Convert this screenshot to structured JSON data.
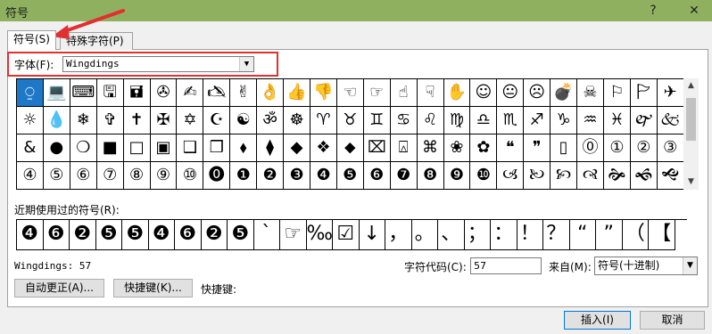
{
  "window": {
    "title": "符号",
    "help": "?",
    "close": "✕",
    "titlebar_color": "#8fb15f"
  },
  "tabs": [
    {
      "label": "符号(S)",
      "active": true
    },
    {
      "label": "特殊字符(P)",
      "active": false
    }
  ],
  "font": {
    "label": "字体(F):",
    "value": "Wingdings"
  },
  "symbol_grid": {
    "rows": [
      [
        "⍜",
        "💻",
        "⌨",
        "🖫",
        "🖬",
        "✇",
        "✍",
        "🖎",
        "✌",
        "👌",
        "👍",
        "👎",
        "☜",
        "☞",
        "☝",
        "☟",
        "✋",
        "☺",
        "😐",
        "☹",
        "💣",
        "☠",
        "⚐",
        "🏱",
        "✈"
      ],
      [
        "☼",
        "💧",
        "❄",
        "✞",
        "✝",
        "✠",
        "✡",
        "☪",
        "☯",
        "ॐ",
        "☸",
        "♈",
        "♉",
        "♊",
        "♋",
        "♌",
        "♍",
        "♎",
        "♏",
        "♐",
        "♑",
        "♒",
        "♓",
        "🙰",
        "🙵"
      ],
      [
        "&",
        "●",
        "❍",
        "■",
        "□",
        "▣",
        "❑",
        "❒",
        "⬧",
        "⧫",
        "◆",
        "❖",
        "⬥",
        "⌧",
        "⍓",
        "⌘",
        "❀",
        "✿",
        "❝",
        "❞",
        "▯",
        "⓪",
        "①",
        "②",
        "③"
      ],
      [
        "④",
        "⑤",
        "⑥",
        "⑦",
        "⑧",
        "⑨",
        "⑩",
        "⓿",
        "❶",
        "❷",
        "❸",
        "❹",
        "❺",
        "❻",
        "❼",
        "❽",
        "❾",
        "❿",
        "🙢",
        "🙠",
        "🙡",
        "🙣",
        "🙞",
        "🙜",
        "🙝"
      ]
    ],
    "selected_index": 0
  },
  "recent": {
    "label": "近期使用过的符号(R):",
    "symbols": [
      "❹",
      "❻",
      "❷",
      "❺",
      "❺",
      "❹",
      "❻",
      "❷",
      "❺",
      "`",
      "☞",
      "‰",
      "☑",
      "↓",
      "，",
      "。",
      "、",
      "；",
      "：",
      "！",
      "？",
      "“",
      "”",
      "（",
      "【"
    ]
  },
  "status": {
    "text": "Wingdings: 57"
  },
  "char_code": {
    "label": "字符代码(C):",
    "value": "57"
  },
  "from": {
    "label": "来自(M):",
    "value": "符号(十进制)"
  },
  "buttons": {
    "autocorrect": "自动更正(A)...",
    "shortcut_key": "快捷键(K)...",
    "shortcut_label": "快捷键:",
    "insert": "插入(I)",
    "cancel": "取消"
  },
  "icons": {
    "combo_arrow": "▼",
    "scroll_up": "▲",
    "scroll_down": "▼"
  },
  "colors": {
    "highlight_box": "#e03030",
    "annotation_arrow": "#e03030",
    "selection": "#1e78c8"
  }
}
